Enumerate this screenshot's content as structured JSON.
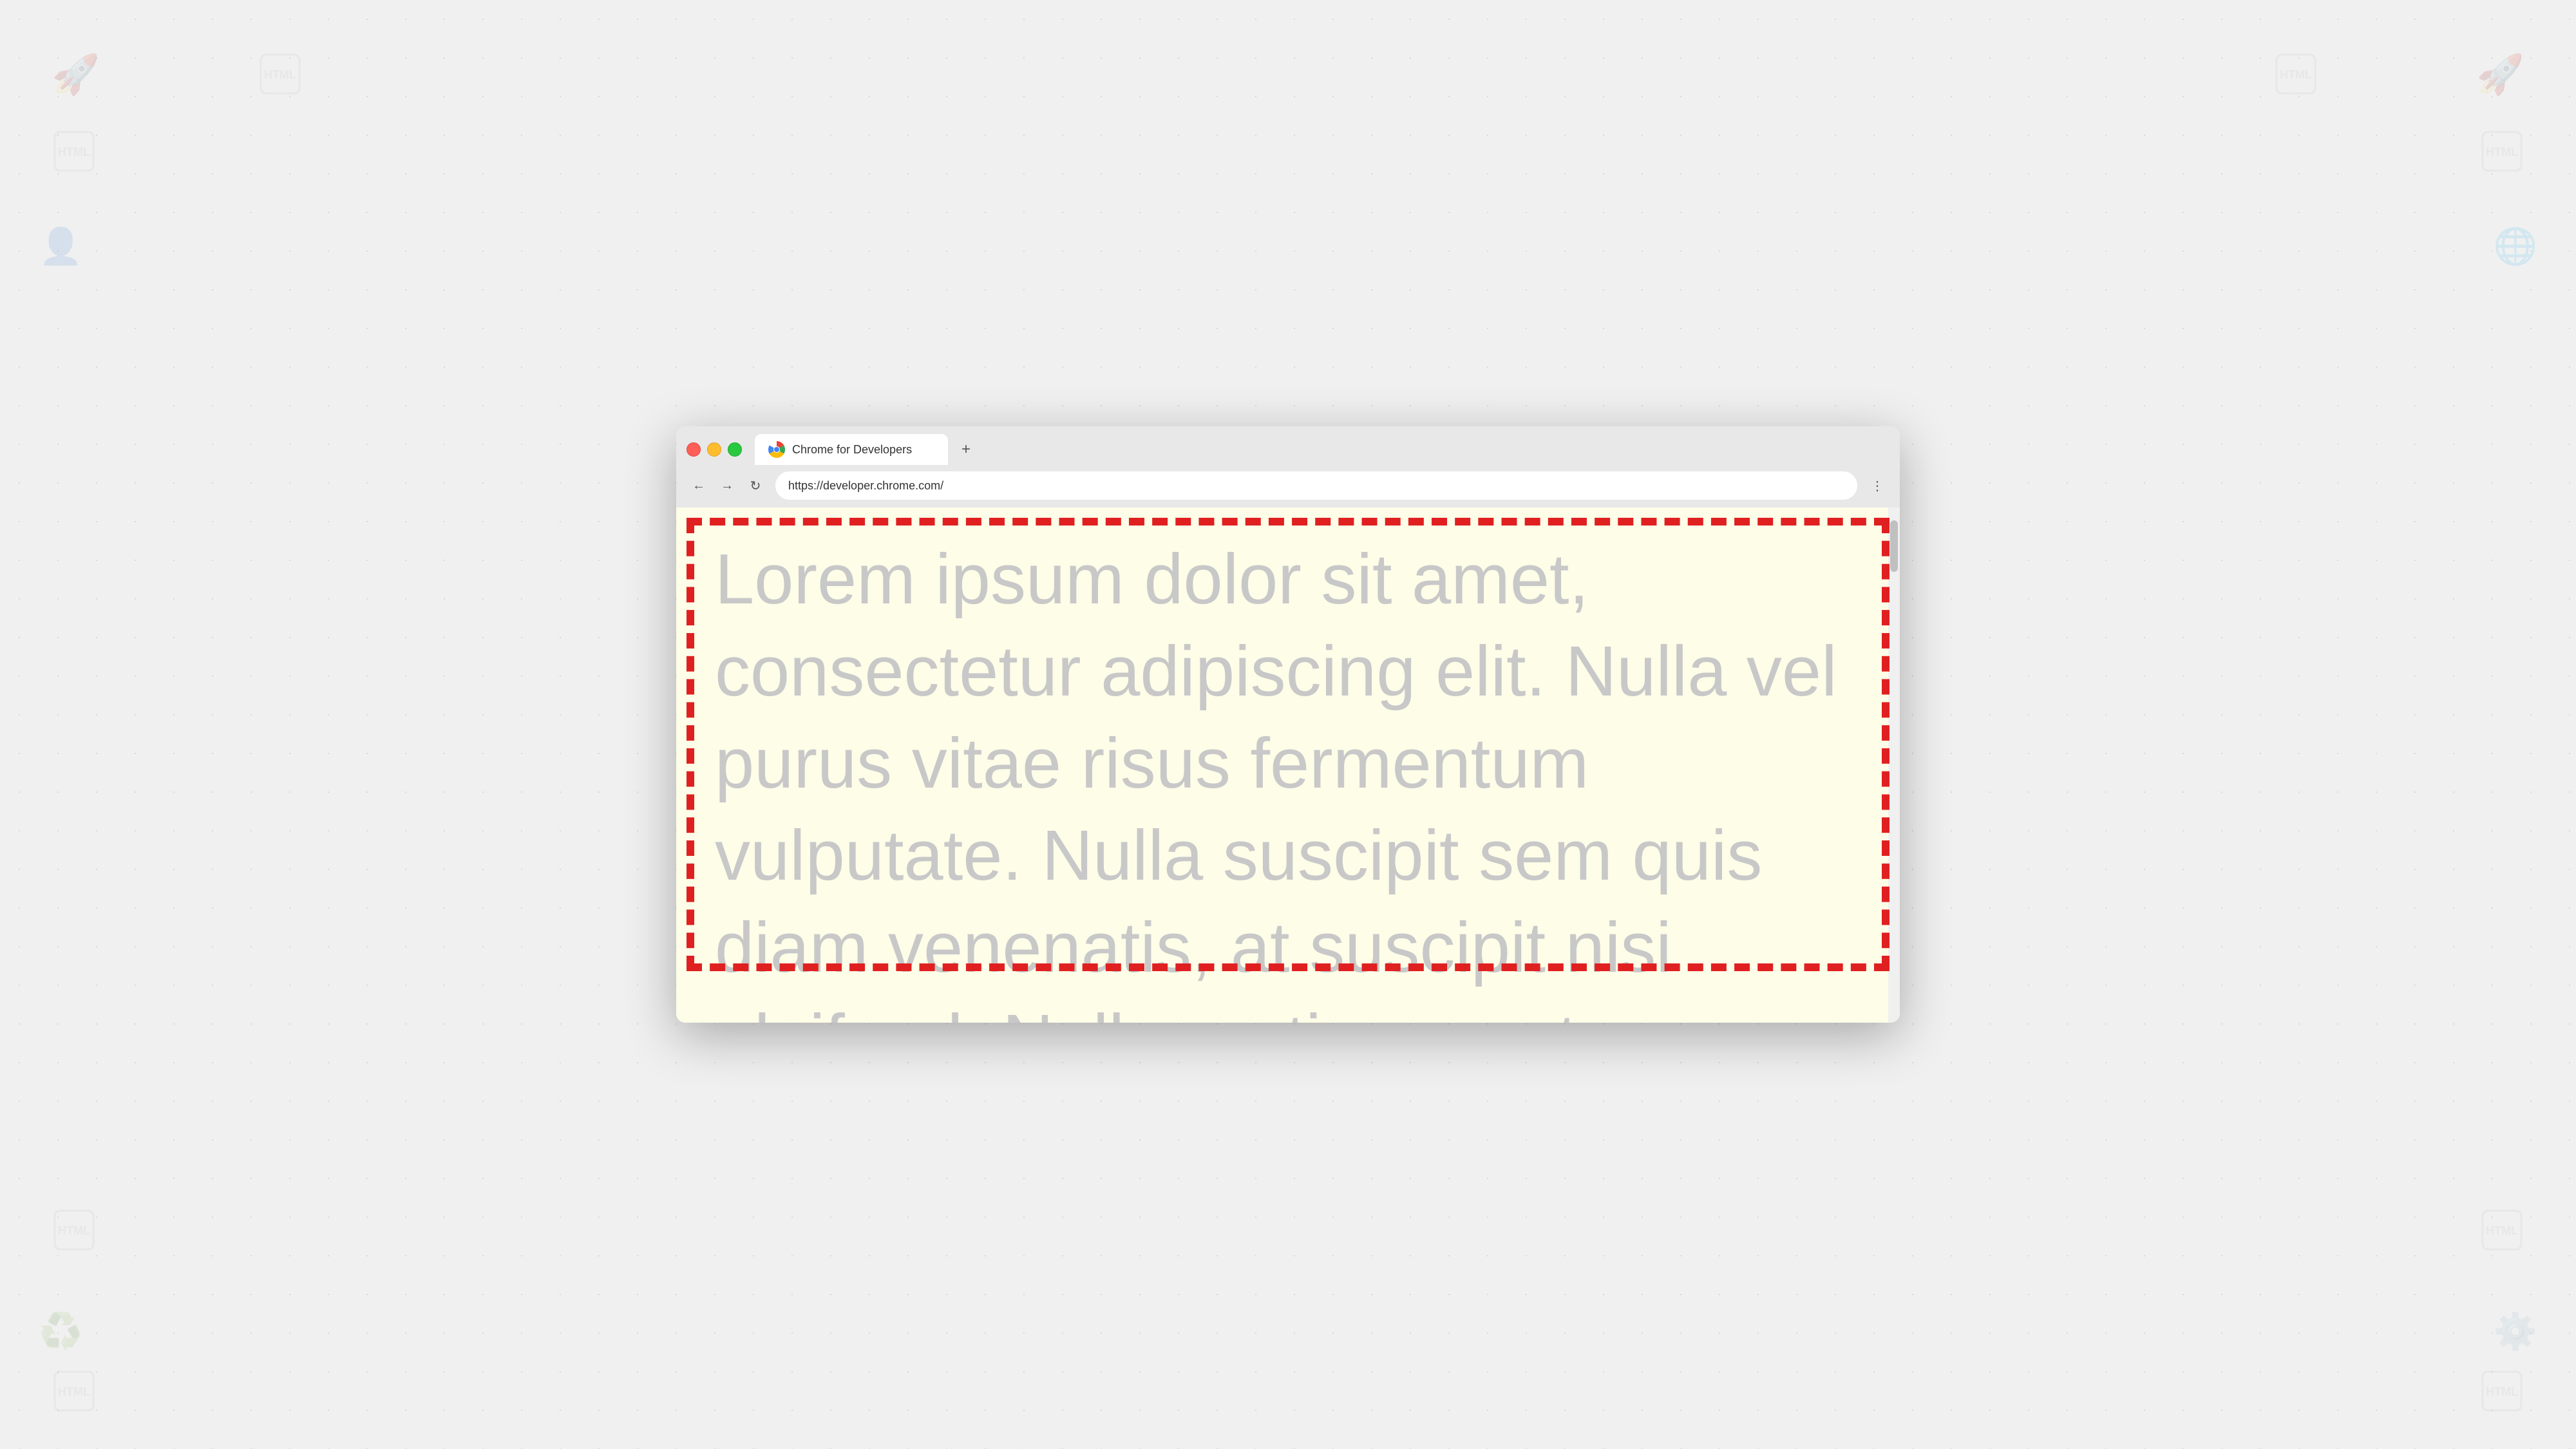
{
  "background": {
    "color": "#f0f0f0"
  },
  "browser": {
    "tab": {
      "title": "Chrome for Developers",
      "favicon_alt": "Chrome logo"
    },
    "new_tab_button": "+",
    "address_bar": {
      "url": "https://developer.chrome.com/"
    },
    "nav": {
      "back_label": "←",
      "forward_label": "→",
      "reload_label": "↻",
      "menu_label": "⋮"
    }
  },
  "page": {
    "lorem_text": "Lorem ipsum dolor sit amet, consectetur adipiscing elit. Nulla vel purus vitae risus fermentum vulputate. Nulla suscipit sem quis diam venenatis, at suscipit nisi eleifend. Nulla pretium eget"
  }
}
